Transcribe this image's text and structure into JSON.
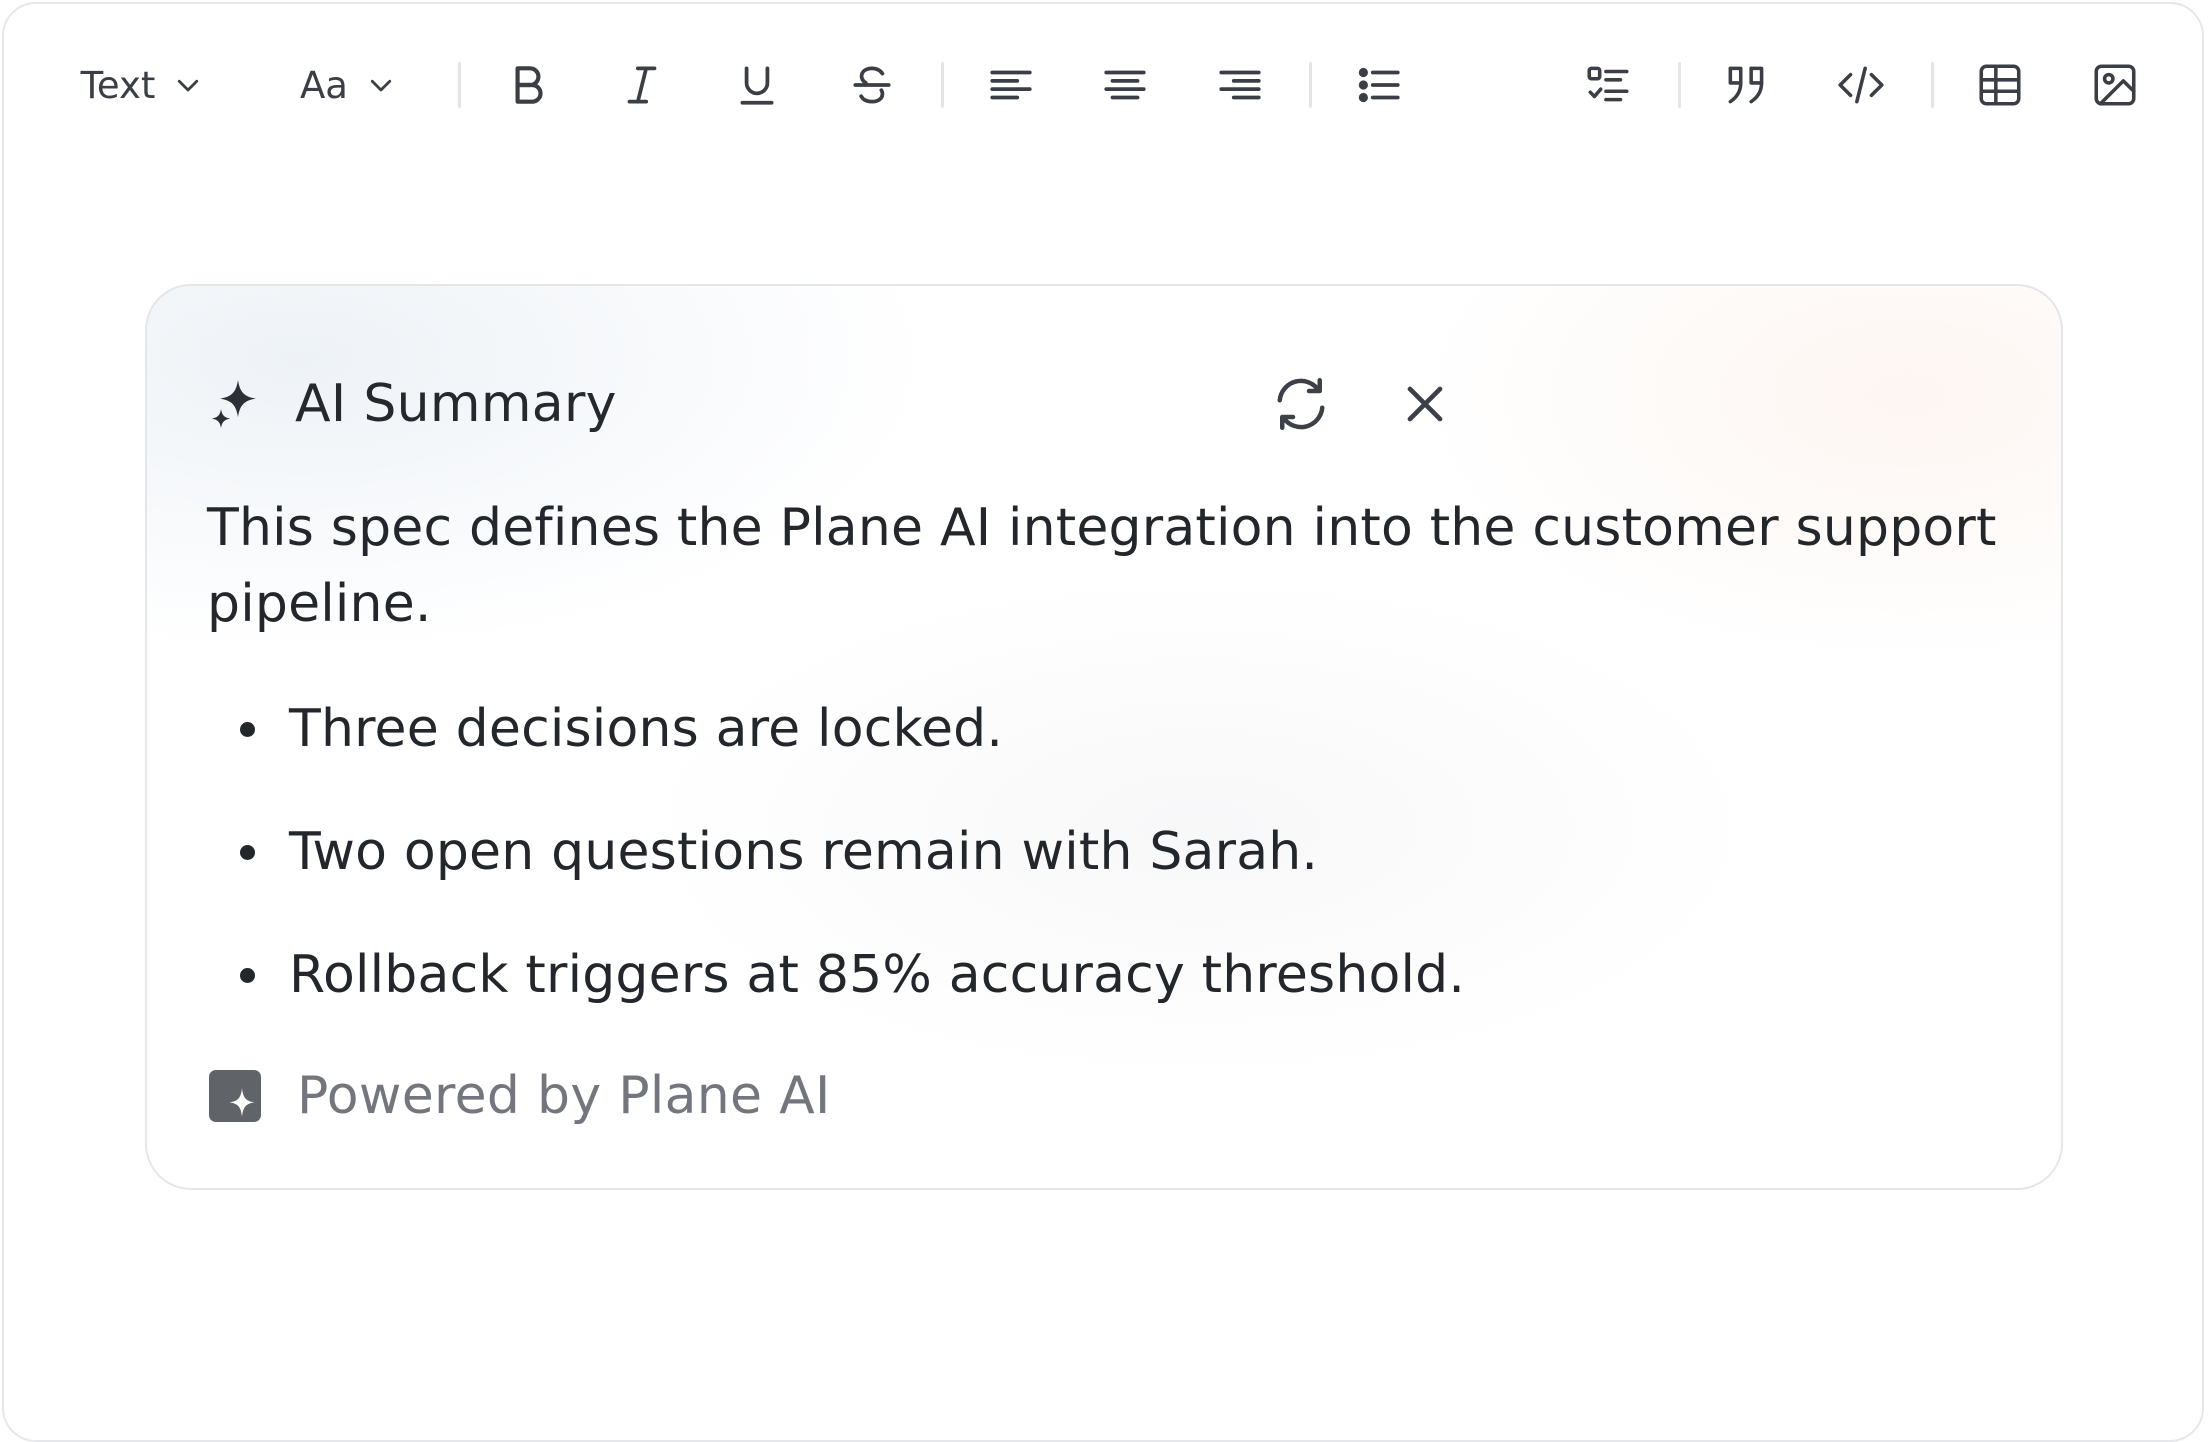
{
  "toolbar": {
    "text_style_label": "Text",
    "font_size_label": "Aa",
    "icons": [
      "bold-icon",
      "italic-icon",
      "underline-icon",
      "strikethrough-icon",
      "align-left-icon",
      "align-center-icon",
      "align-right-icon",
      "bullet-list-icon",
      "checklist-icon",
      "quote-icon",
      "code-icon",
      "table-icon",
      "image-icon"
    ]
  },
  "summary_card": {
    "title": "AI Summary",
    "intro": "This spec defines the Plane AI integration into the customer support pipeline.",
    "bullets": [
      "Three decisions are locked.",
      "Two open questions remain with Sarah.",
      "Rollback triggers at 85% accuracy threshold."
    ],
    "footer": "Powered by Plane AI"
  },
  "colors": {
    "icon": "#3b3f45",
    "text": "#23272c",
    "muted_text": "#73777d",
    "border": "#e5e6e9",
    "logo": "#606469"
  }
}
